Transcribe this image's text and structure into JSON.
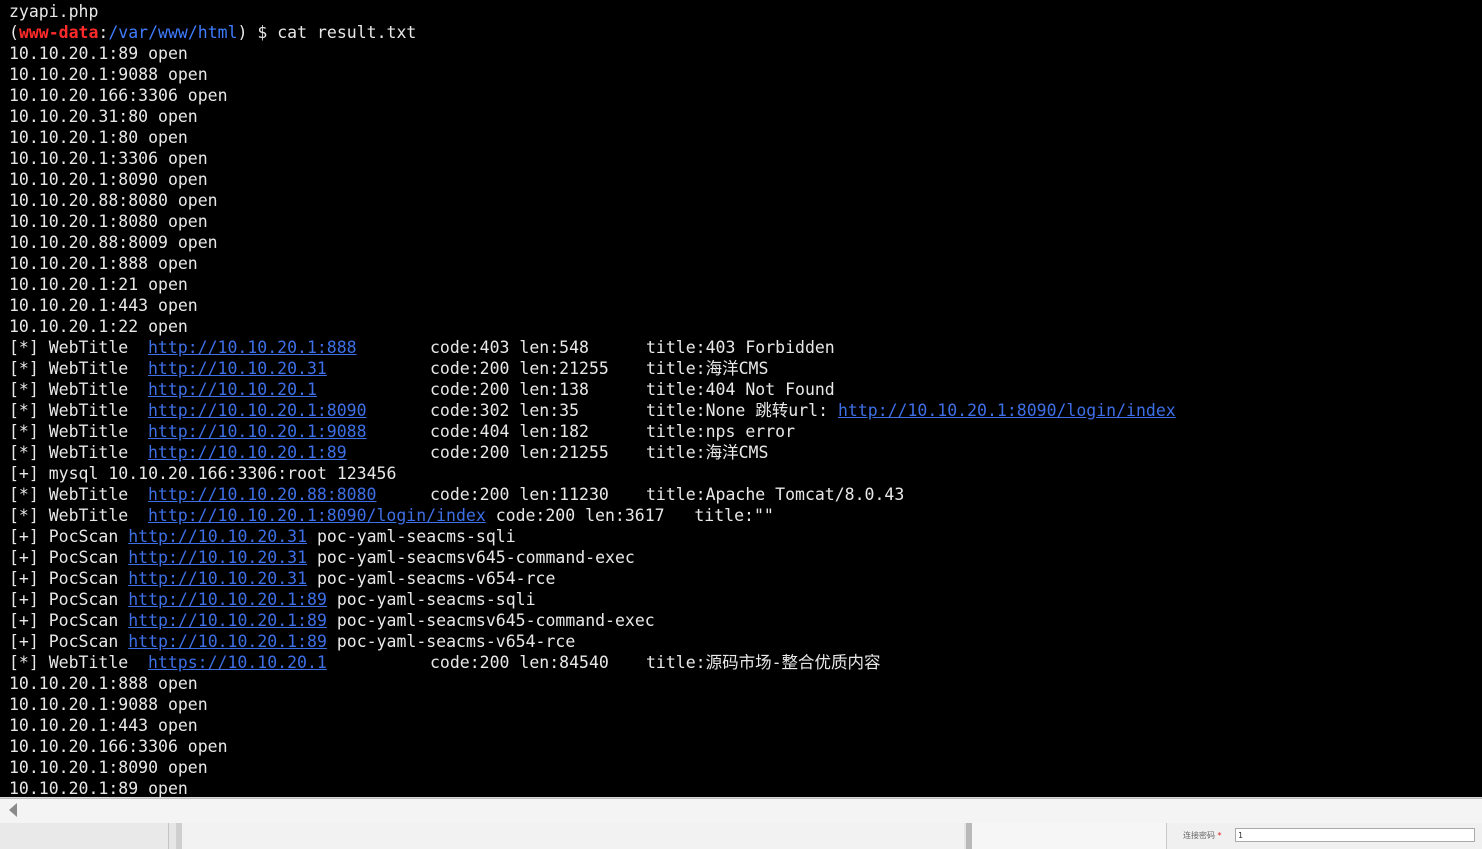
{
  "terminal": {
    "prev_line": "zyapi.php",
    "prompt": {
      "open": "(",
      "user": "www-data",
      "colon": ":",
      "path": "/var/www/html",
      "close": ")",
      "dollar": " $ ",
      "command": "cat result.txt"
    },
    "ports_block_1": [
      "10.10.20.1:89 open",
      "10.10.20.1:9088 open",
      "10.10.20.166:3306 open",
      "10.10.20.31:80 open",
      "10.10.20.1:80 open",
      "10.10.20.1:3306 open",
      "10.10.20.1:8090 open",
      "10.10.20.88:8080 open",
      "10.10.20.1:8080 open",
      "10.10.20.88:8009 open",
      "10.10.20.1:888 open",
      "10.10.20.1:21 open",
      "10.10.20.1:443 open",
      "10.10.20.1:22 open"
    ],
    "webtitles_1": [
      {
        "tag": "[*] WebTitle ",
        "url": "http://10.10.20.1:888",
        "code": "code:403 len:548",
        "title": "title:403 Forbidden"
      },
      {
        "tag": "[*] WebTitle ",
        "url": "http://10.10.20.31",
        "code": "code:200 len:21255",
        "title": "title:海洋CMS"
      },
      {
        "tag": "[*] WebTitle ",
        "url": "http://10.10.20.1",
        "code": "code:200 len:138",
        "title": "title:404 Not Found"
      },
      {
        "tag": "[*] WebTitle ",
        "url": "http://10.10.20.1:8090",
        "code": "code:302 len:35",
        "title": "title:None 跳转url: ",
        "link": "http://10.10.20.1:8090/login/index"
      },
      {
        "tag": "[*] WebTitle ",
        "url": "http://10.10.20.1:9088",
        "code": "code:404 len:182",
        "title": "title:nps error"
      },
      {
        "tag": "[*] WebTitle ",
        "url": "http://10.10.20.1:89",
        "code": "code:200 len:21255",
        "title": "title:海洋CMS"
      }
    ],
    "mysql_line": "[+] mysql 10.10.20.166:3306:root 123456",
    "webtitle_tomcat": {
      "tag": "[*] WebTitle ",
      "url": "http://10.10.20.88:8080",
      "code": "code:200 len:11230",
      "title": "title:Apache Tomcat/8.0.43"
    },
    "webtitle_login": {
      "tag": "[*] WebTitle ",
      "url": "http://10.10.20.1:8090/login/index",
      "rest": " code:200 len:3617   title:\"\""
    },
    "pocscans": [
      {
        "tag": "[+] PocScan ",
        "url": "http://10.10.20.31",
        "poc": "poc-yaml-seacms-sqli"
      },
      {
        "tag": "[+] PocScan ",
        "url": "http://10.10.20.31",
        "poc": "poc-yaml-seacmsv645-command-exec"
      },
      {
        "tag": "[+] PocScan ",
        "url": "http://10.10.20.31",
        "poc": "poc-yaml-seacms-v654-rce"
      },
      {
        "tag": "[+] PocScan ",
        "url": "http://10.10.20.1:89",
        "poc": "poc-yaml-seacms-sqli"
      },
      {
        "tag": "[+] PocScan ",
        "url": "http://10.10.20.1:89",
        "poc": "poc-yaml-seacmsv645-command-exec"
      },
      {
        "tag": "[+] PocScan ",
        "url": "http://10.10.20.1:89",
        "poc": "poc-yaml-seacms-v654-rce"
      }
    ],
    "webtitle_https": {
      "tag": "[*] WebTitle ",
      "url": "https://10.10.20.1",
      "code": "code:200 len:84540",
      "title": "title:源码市场-整合优质内容"
    },
    "ports_block_2": [
      "10.10.20.1:888 open",
      "10.10.20.1:9088 open",
      "10.10.20.1:443 open",
      "10.10.20.166:3306 open",
      "10.10.20.1:8090 open",
      "10.10.20.1:89 open"
    ]
  },
  "bottom": {
    "conn_label": "连接密码",
    "required_mark": "*",
    "conn_input_value": "1"
  },
  "colors": {
    "background": "#000000",
    "text": "#e8e8e8",
    "link": "#3d6fe6",
    "prompt_user": "#ff2a2a",
    "prompt_path": "#3f7cff"
  }
}
